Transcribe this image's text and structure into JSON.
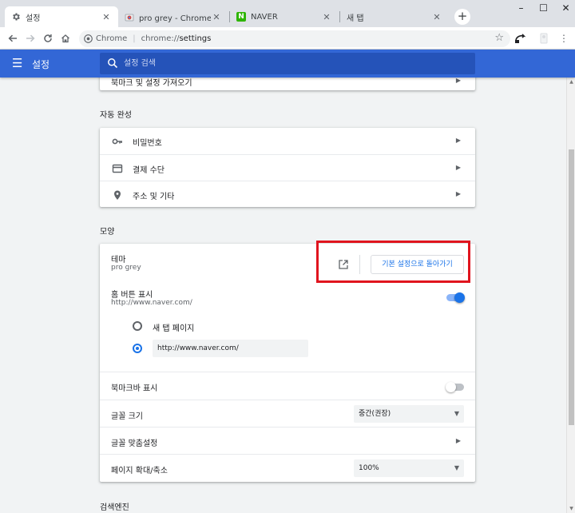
{
  "browser": {
    "tabs": [
      {
        "title": "설정",
        "favicon": "gear-icon"
      },
      {
        "title": "pro grey - Chrome 웹 스",
        "favicon": "chrome-webstore-icon"
      },
      {
        "title": "NAVER",
        "favicon": "naver-icon",
        "favicon_text": "N"
      },
      {
        "title": "새 탭",
        "favicon": ""
      }
    ],
    "new_tab_glyph": "+",
    "window_controls": [
      "–",
      "☐",
      "✕"
    ],
    "omnibox": {
      "chip": "Chrome",
      "separator": "|",
      "url_scheme": "chrome://",
      "url_path": "settings"
    }
  },
  "header": {
    "title": "설정",
    "search_placeholder": "설정 검색"
  },
  "sections": {
    "cut_row_label": "북마크 및 설정 가져오기",
    "autofill": {
      "title": "자동 완성",
      "items": [
        {
          "label": "비밀번호",
          "icon": "key-icon"
        },
        {
          "label": "결제 수단",
          "icon": "credit-card-icon"
        },
        {
          "label": "주소 및 기타",
          "icon": "location-pin-icon"
        }
      ]
    },
    "appearance": {
      "title": "모양",
      "theme": {
        "label": "테마",
        "value": "pro grey",
        "reset_button": "기본 설정으로 돌아가기"
      },
      "home_button": {
        "label": "홈 버튼 표시",
        "value": "http://www.naver.com/",
        "enabled": true
      },
      "home_options": [
        {
          "label": "새 탭 페이지",
          "checked": false
        },
        {
          "label": "http://www.naver.com/",
          "checked": true
        }
      ],
      "bookmarks_bar": {
        "label": "북마크바 표시",
        "enabled": false
      },
      "font_size": {
        "label": "글꼴 크기",
        "value": "중간(권장)"
      },
      "customize_fonts": {
        "label": "글꼴 맞춤설정"
      },
      "page_zoom": {
        "label": "페이지 확대/축소",
        "value": "100%"
      }
    },
    "search_engine": {
      "title": "검색엔진"
    }
  },
  "colors": {
    "header": "#3367d6",
    "accent": "#1a73e8",
    "highlight_border": "#e0141e"
  }
}
